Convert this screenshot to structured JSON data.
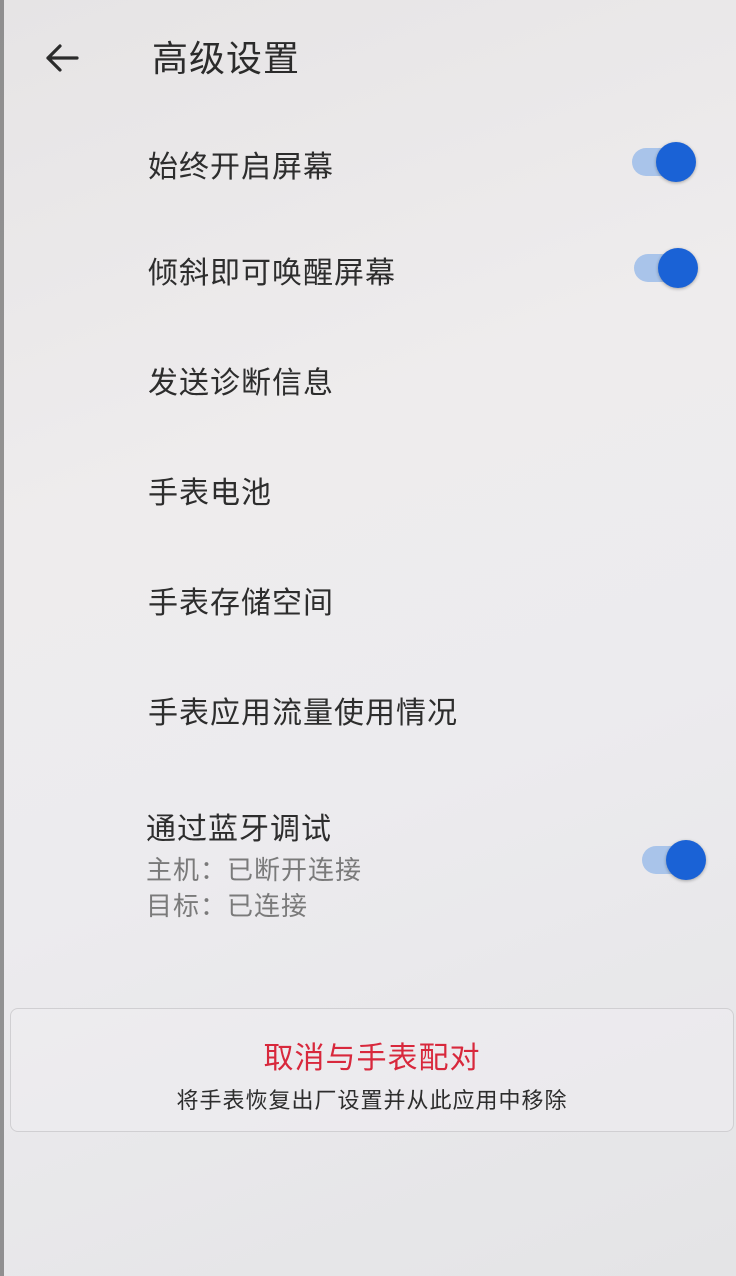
{
  "header": {
    "title": "高级设置",
    "back_icon": "arrow-left-icon"
  },
  "settings": {
    "always_on_screen": {
      "label": "始终开启屏幕",
      "enabled": true
    },
    "tilt_to_wake": {
      "label": "倾斜即可唤醒屏幕",
      "enabled": true
    },
    "send_diagnostics": {
      "label": "发送诊断信息"
    },
    "watch_battery": {
      "label": "手表电池"
    },
    "watch_storage": {
      "label": "手表存储空间"
    },
    "watch_app_data_usage": {
      "label": "手表应用流量使用情况"
    },
    "bluetooth_debugging": {
      "label": "通过蓝牙调试",
      "host_status": "主机：已断开连接",
      "target_status": "目标：已连接",
      "enabled": true
    }
  },
  "unpair": {
    "title": "取消与手表配对",
    "description": "将手表恢复出厂设置并从此应用中移除"
  },
  "colors": {
    "toggle_on_thumb": "#1a62d6",
    "toggle_on_track": "#a9c4ea",
    "danger_text": "#d8283c"
  }
}
